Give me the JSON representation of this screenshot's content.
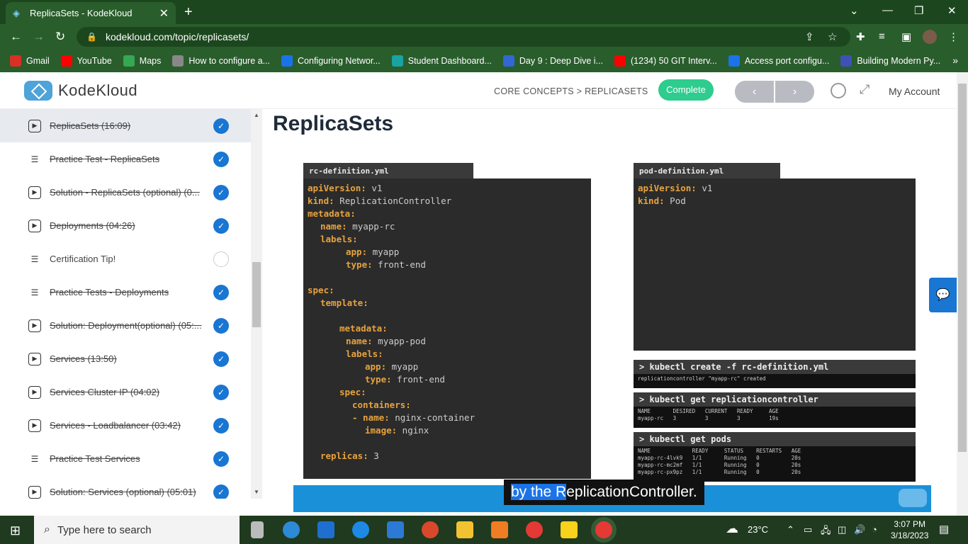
{
  "browser": {
    "tab_title": "ReplicaSets - KodeKloud",
    "url": "kodekloud.com/topic/replicasets/",
    "bookmarks": [
      {
        "label": "Gmail",
        "color": "#d93025"
      },
      {
        "label": "YouTube",
        "color": "#ff0000"
      },
      {
        "label": "Maps",
        "color": "#34a853"
      },
      {
        "label": "How to configure a...",
        "color": "#888888"
      },
      {
        "label": "Configuring Networ...",
        "color": "#1a73e8"
      },
      {
        "label": "Student Dashboard...",
        "color": "#1aa3a3"
      },
      {
        "label": "Day 9 : Deep Dive i...",
        "color": "#3367d6"
      },
      {
        "label": "(1234) 50 GIT Interv...",
        "color": "#ff0000"
      },
      {
        "label": "Access port configu...",
        "color": "#1a73e8"
      },
      {
        "label": "Building Modern Py...",
        "color": "#3f51b5"
      }
    ]
  },
  "header": {
    "logo_text": "KodeKloud",
    "breadcrumb": "CORE CONCEPTS > REPLICASETS",
    "complete_label": "Complete",
    "prev_label": "‹",
    "next_label": "›",
    "account_label": "My Account"
  },
  "sidebar": {
    "items": [
      {
        "label": "ReplicaSets (16:09)",
        "type": "video",
        "done": true,
        "active": true
      },
      {
        "label": "Practice Test - ReplicaSets",
        "type": "lab",
        "done": true
      },
      {
        "label": "Solution - ReplicaSets (optional) (0...",
        "type": "video",
        "done": true
      },
      {
        "label": "Deployments (04:26)",
        "type": "video",
        "done": true
      },
      {
        "label": "Certification Tip!",
        "type": "lab",
        "done": false
      },
      {
        "label": "Practice Tests - Deployments",
        "type": "lab",
        "done": true
      },
      {
        "label": "Solution: Deployment(optional) (05:...",
        "type": "video",
        "done": true
      },
      {
        "label": "Services (13:50)",
        "type": "video",
        "done": true
      },
      {
        "label": "Services Cluster IP (04:02)",
        "type": "video",
        "done": true
      },
      {
        "label": "Services - Loadbalancer (03:42)",
        "type": "video",
        "done": true
      },
      {
        "label": "Practice Test Services",
        "type": "lab",
        "done": true
      },
      {
        "label": "Solution: Services (optional) (05:01)",
        "type": "video",
        "done": true
      }
    ]
  },
  "main": {
    "title": "ReplicaSets",
    "rc_file": "rc-definition.yml",
    "rc_lines": [
      {
        "indent": 0,
        "key": "apiVersion:",
        "val": " v1"
      },
      {
        "indent": 0,
        "key": "kind:",
        "val": " ReplicationController"
      },
      {
        "indent": 0,
        "key": "metadata:",
        "val": ""
      },
      {
        "indent": 2,
        "key": "name:",
        "val": " myapp-rc"
      },
      {
        "indent": 2,
        "key": "labels:",
        "val": ""
      },
      {
        "indent": 6,
        "key": "app:",
        "val": " myapp"
      },
      {
        "indent": 6,
        "key": "type:",
        "val": " front-end"
      },
      {
        "indent": 0,
        "key": "",
        "val": ""
      },
      {
        "indent": 0,
        "key": "spec:",
        "val": ""
      },
      {
        "indent": 2,
        "key": "template:",
        "val": ""
      },
      {
        "indent": 0,
        "key": "",
        "val": ""
      },
      {
        "indent": 5,
        "key": "metadata:",
        "val": ""
      },
      {
        "indent": 6,
        "key": "name:",
        "val": " myapp-pod"
      },
      {
        "indent": 6,
        "key": "labels:",
        "val": ""
      },
      {
        "indent": 9,
        "key": "app:",
        "val": " myapp"
      },
      {
        "indent": 9,
        "key": "type:",
        "val": " front-end"
      },
      {
        "indent": 5,
        "key": "spec:",
        "val": ""
      },
      {
        "indent": 7,
        "key": "containers:",
        "val": ""
      },
      {
        "indent": 7,
        "key": "- name:",
        "val": " nginx-container"
      },
      {
        "indent": 9,
        "key": "image:",
        "val": " nginx"
      },
      {
        "indent": 0,
        "key": "",
        "val": ""
      },
      {
        "indent": 2,
        "key": "replicas:",
        "val": " 3"
      }
    ],
    "pod_file": "pod-definition.yml",
    "pod_lines": [
      {
        "key": "apiVersion:",
        "val": " v1"
      },
      {
        "key": "kind:",
        "val": " Pod"
      }
    ],
    "terminal": [
      {
        "cmd": "> kubectl create -f rc-definition.yml",
        "out": "replicationcontroller \"myapp-rc\" created"
      },
      {
        "cmd": "> kubectl get replicationcontroller",
        "out": "NAME       DESIRED   CURRENT   READY     AGE\nmyapp-rc   3         3         3         19s"
      },
      {
        "cmd": "> kubectl get pods",
        "out": "NAME             READY     STATUS    RESTARTS   AGE\nmyapp-rc-4lvk9   1/1       Running   0          20s\nmyapp-rc-mc2mf   1/1       Running   0          20s\nmyapp-rc-px9pz   1/1       Running   0          20s"
      }
    ],
    "caption_highlight": "by the R",
    "caption_rest": "eplicationController."
  },
  "taskbar": {
    "search_placeholder": "Type here to search",
    "weather": "23°C",
    "time": "3:07 PM",
    "date": "3/18/2023"
  }
}
